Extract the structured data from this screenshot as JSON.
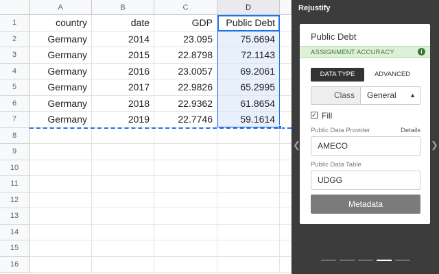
{
  "sheet": {
    "columns": [
      "A",
      "B",
      "C",
      "D"
    ],
    "rows": [
      "1",
      "2",
      "3",
      "4",
      "5",
      "6",
      "7",
      "8",
      "9",
      "10",
      "11",
      "12",
      "13",
      "14",
      "15",
      "16"
    ],
    "cells": [
      [
        "country",
        "date",
        "GDP",
        "Public Debt"
      ],
      [
        "Germany",
        "2014",
        "23.095",
        "75.6694"
      ],
      [
        "Germany",
        "2015",
        "22.8798",
        "72.1143"
      ],
      [
        "Germany",
        "2016",
        "23.0057",
        "69.2061"
      ],
      [
        "Germany",
        "2017",
        "22.9826",
        "65.2995"
      ],
      [
        "Germany",
        "2018",
        "22.9362",
        "61.8654"
      ],
      [
        "Germany",
        "2019",
        "22.7746",
        "59.1614"
      ]
    ],
    "selected_column": "D"
  },
  "panel": {
    "app_title": "Rejustify",
    "prev_icon": "chevron-left-icon",
    "next_icon": "chevron-right-icon",
    "card_title": "Public Debt",
    "accuracy_label": "ASSIGNMENT ACCURACY",
    "accuracy_icon": "info-icon",
    "accuracy_color": "#3c763d",
    "tabs": {
      "data_type": "DATA TYPE",
      "advanced": "ADVANCED"
    },
    "class_label": "Class",
    "class_value": "General",
    "fill_label": "Fill",
    "fill_checked": true,
    "provider_label": "Public Data Provider",
    "details_link": "Details",
    "provider_value": "AMECO",
    "table_label": "Public Data Table",
    "table_value": "UDGG",
    "metadata_button": "Metadata",
    "pager": {
      "pages": 5,
      "active_index": 3
    }
  },
  "colors": {
    "selection_blue": "#1a73e8",
    "panel_bg": "#3c3c3c",
    "button_gray": "#7b7b7b"
  }
}
